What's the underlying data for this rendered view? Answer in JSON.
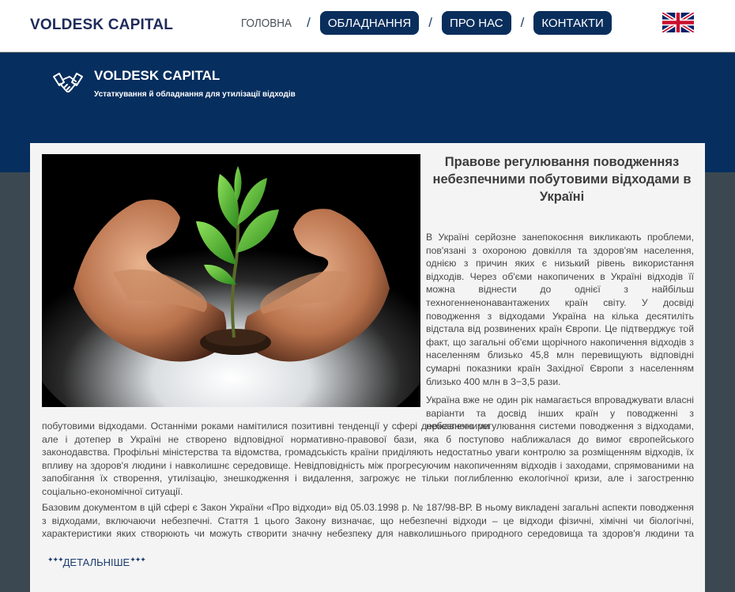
{
  "header": {
    "logo": "VOLDESK CAPITAL",
    "nav": [
      {
        "label": "ГОЛОВНА",
        "active": false
      },
      {
        "label": "ОБЛАДНАННЯ",
        "active": true
      },
      {
        "label": "ПРО НАС",
        "active": true
      },
      {
        "label": "КОНТАКТИ",
        "active": true
      }
    ],
    "separator": "/",
    "language_flag": "uk-flag-icon"
  },
  "band": {
    "title": "VOLDESK CAPITAL",
    "subtitle": "Устаткування й обладнання для утилізації відходів",
    "icon": "handshake-icon"
  },
  "article": {
    "title": "Правове регулювання поводженняз небезпечними побутовими відходами в Україні",
    "paragraph1": "В Україні серйозне занепокоєння викликають проблеми, пов'язані з охороною довкілля та здоров'ям населення, однією з причин яких є низький рівень використання відходів. Через об'єми накопичених в Україні відходів її можна віднести до однієї з найбільш техногенненонавантажених країн світу. У досвіді поводження з відходами Україна на кілька десятиліть відстала від розвинених країн Європи. Це підтверджує той факт, що загальні об'єми щорічного накопичення відходів з населенням близько 45,8 млн перевищують відповідні сумарні показники країн Західної Європи з населенням близько 400 млн в 3−3,5 рази.",
    "paragraph2_start": "Україна вже не один рік намагається впроваджувати власні варіанти та досвід інших країн у поводженні з небезпечними",
    "paragraph2_rest": "побутовими відходами. Останніми роками намітилися позитивні тенденції у сфері державного регулювання системи поводження з відходами, але і дотепер в Україні не створено відповідної нормативно-правової бази, яка б поступово наближалася до вимог європейського законодавства. Профільні міністерства та відомства, громадськість країни приділяють недостатньо уваги контролю за розміщенням відходів, їх впливу на здоров'я людини і навколишнє середовище. Невідповідність між прогресуючим накопиченням відходів і заходами, спрямованими на запобігання їх створення, утилізацію, знешкодження і видалення, загрожує не тільки поглибленню екологічної кризи, але і загостренню соціально-економічної ситуації.",
    "paragraph3": "Базовим документом в цій сфері є Закон України «Про відходи» від 05.03.1998 р. № 187/98-ВР. В ньому викладені загальні аспекти поводження з відходами, включаючи небезпечні. Стаття 1 цього Закону визначає, що небезпечні відходи – це відходи фізичні, хімічні чи біологічні, характеристики яких створюють чи можуть створити значну небезпеку для навколишнього природного середовища та здоров'я людини та вимагають спеціальних",
    "more_link": "ДЕТАЛЬНІШЕ",
    "more_decor": "✦✦✦",
    "image": "hands-holding-seedling"
  },
  "colors": {
    "brand_navy": "#062e5e",
    "pill": "#0a2e5c",
    "background": "#3b4852",
    "card": "#f4f4f4"
  }
}
